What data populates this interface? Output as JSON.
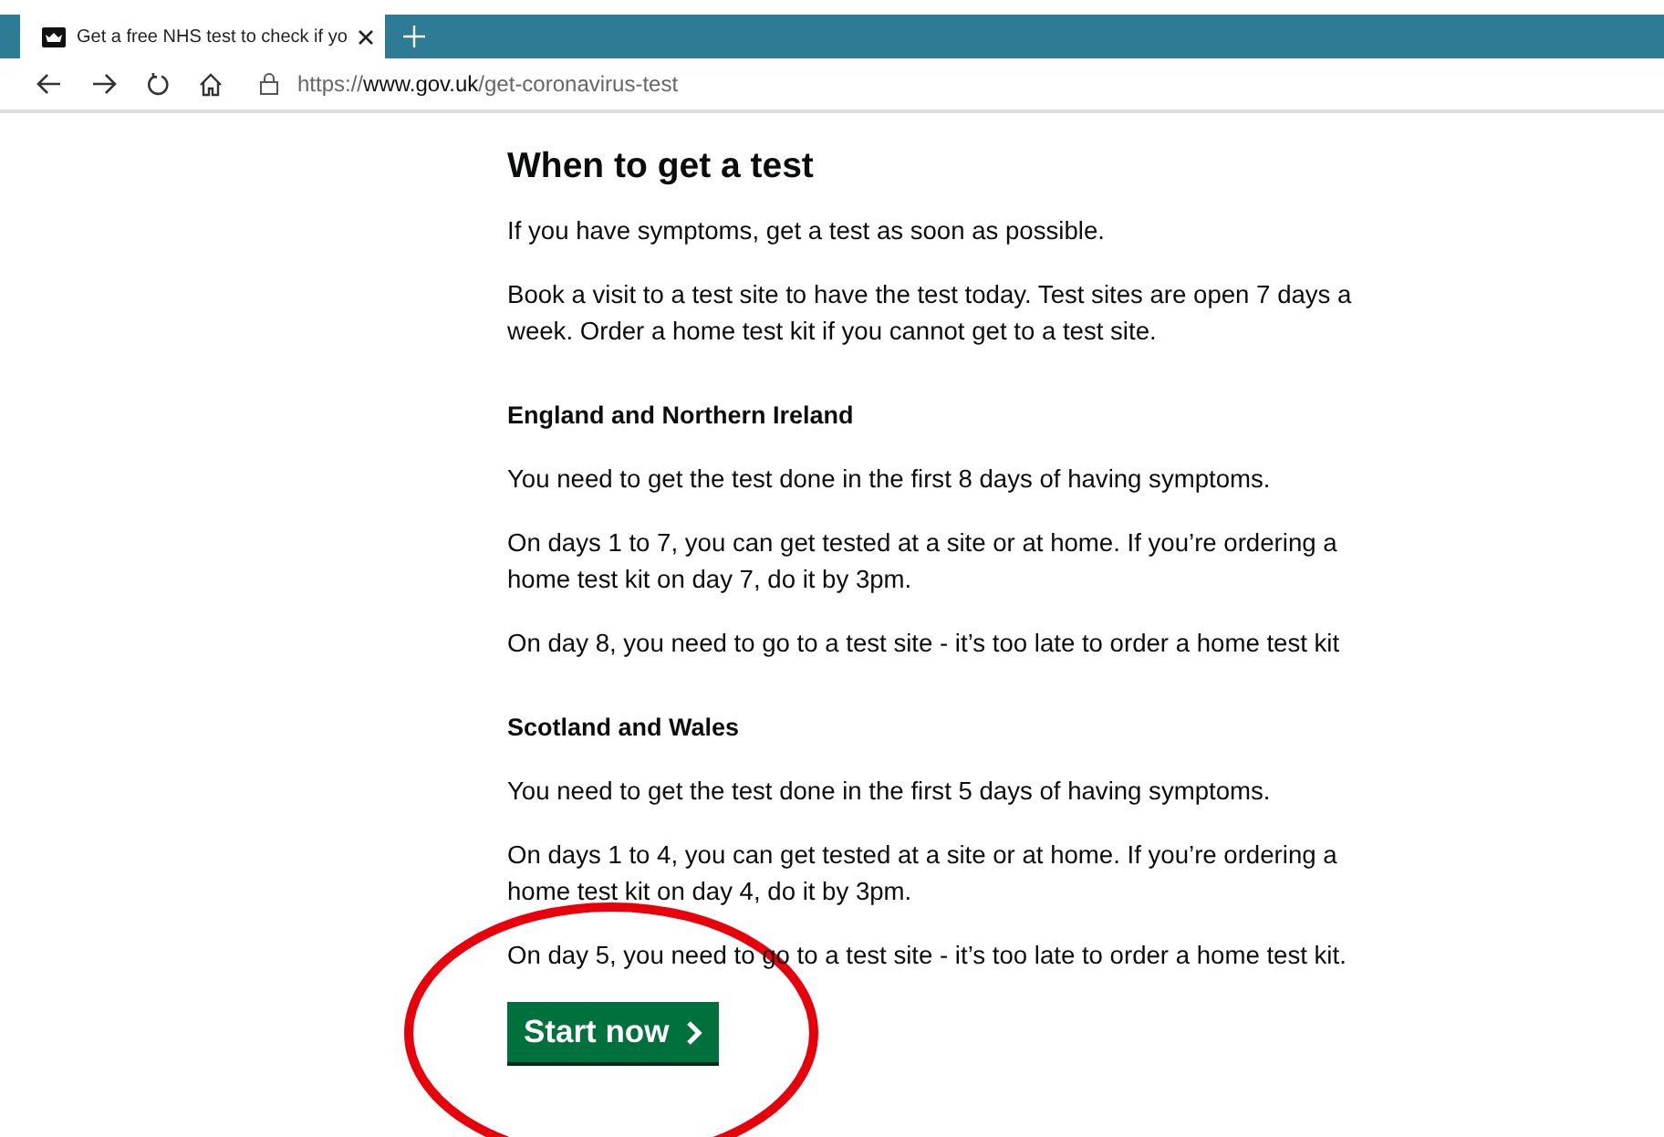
{
  "browser": {
    "tab": {
      "title": "Get a free NHS test to check if yo"
    },
    "address": "https://**www.gov.uk**/get-coronavirus-test"
  },
  "page": {
    "heading": "When to get a test",
    "blocks": [
      {
        "kind": "paragraph",
        "text": "If you have symptoms, get a test as soon as possible."
      },
      {
        "kind": "paragraph",
        "text": "Book a visit to a test site to have the test today. Test sites are open 7 days a week. Order a home test kit if you cannot get to a test site."
      },
      {
        "kind": "subheading",
        "text": "England and Northern Ireland"
      },
      {
        "kind": "paragraph",
        "text": "You need to get the test done in the first 8 days of having symptoms."
      },
      {
        "kind": "paragraph",
        "text": "On days 1 to 7, you can get tested at a site or at home. If you’re ordering a home test kit on day 7, do it by 3pm."
      },
      {
        "kind": "paragraph",
        "text": "On day 8, you need to go to a test site - it’s too late to order a home test kit"
      },
      {
        "kind": "subheading",
        "text": "Scotland and Wales"
      },
      {
        "kind": "paragraph",
        "text": "You need to get the test done in the first 5 days of having symptoms."
      },
      {
        "kind": "paragraph",
        "text": "On days 1 to 4, you can get tested at a site or at home. If you’re ordering a home test kit on day 4, do it by 3pm."
      },
      {
        "kind": "paragraph",
        "text": "On day 5, you need to go to a test site - it’s too late to order a home test kit."
      }
    ],
    "start_button": "Start now"
  }
}
